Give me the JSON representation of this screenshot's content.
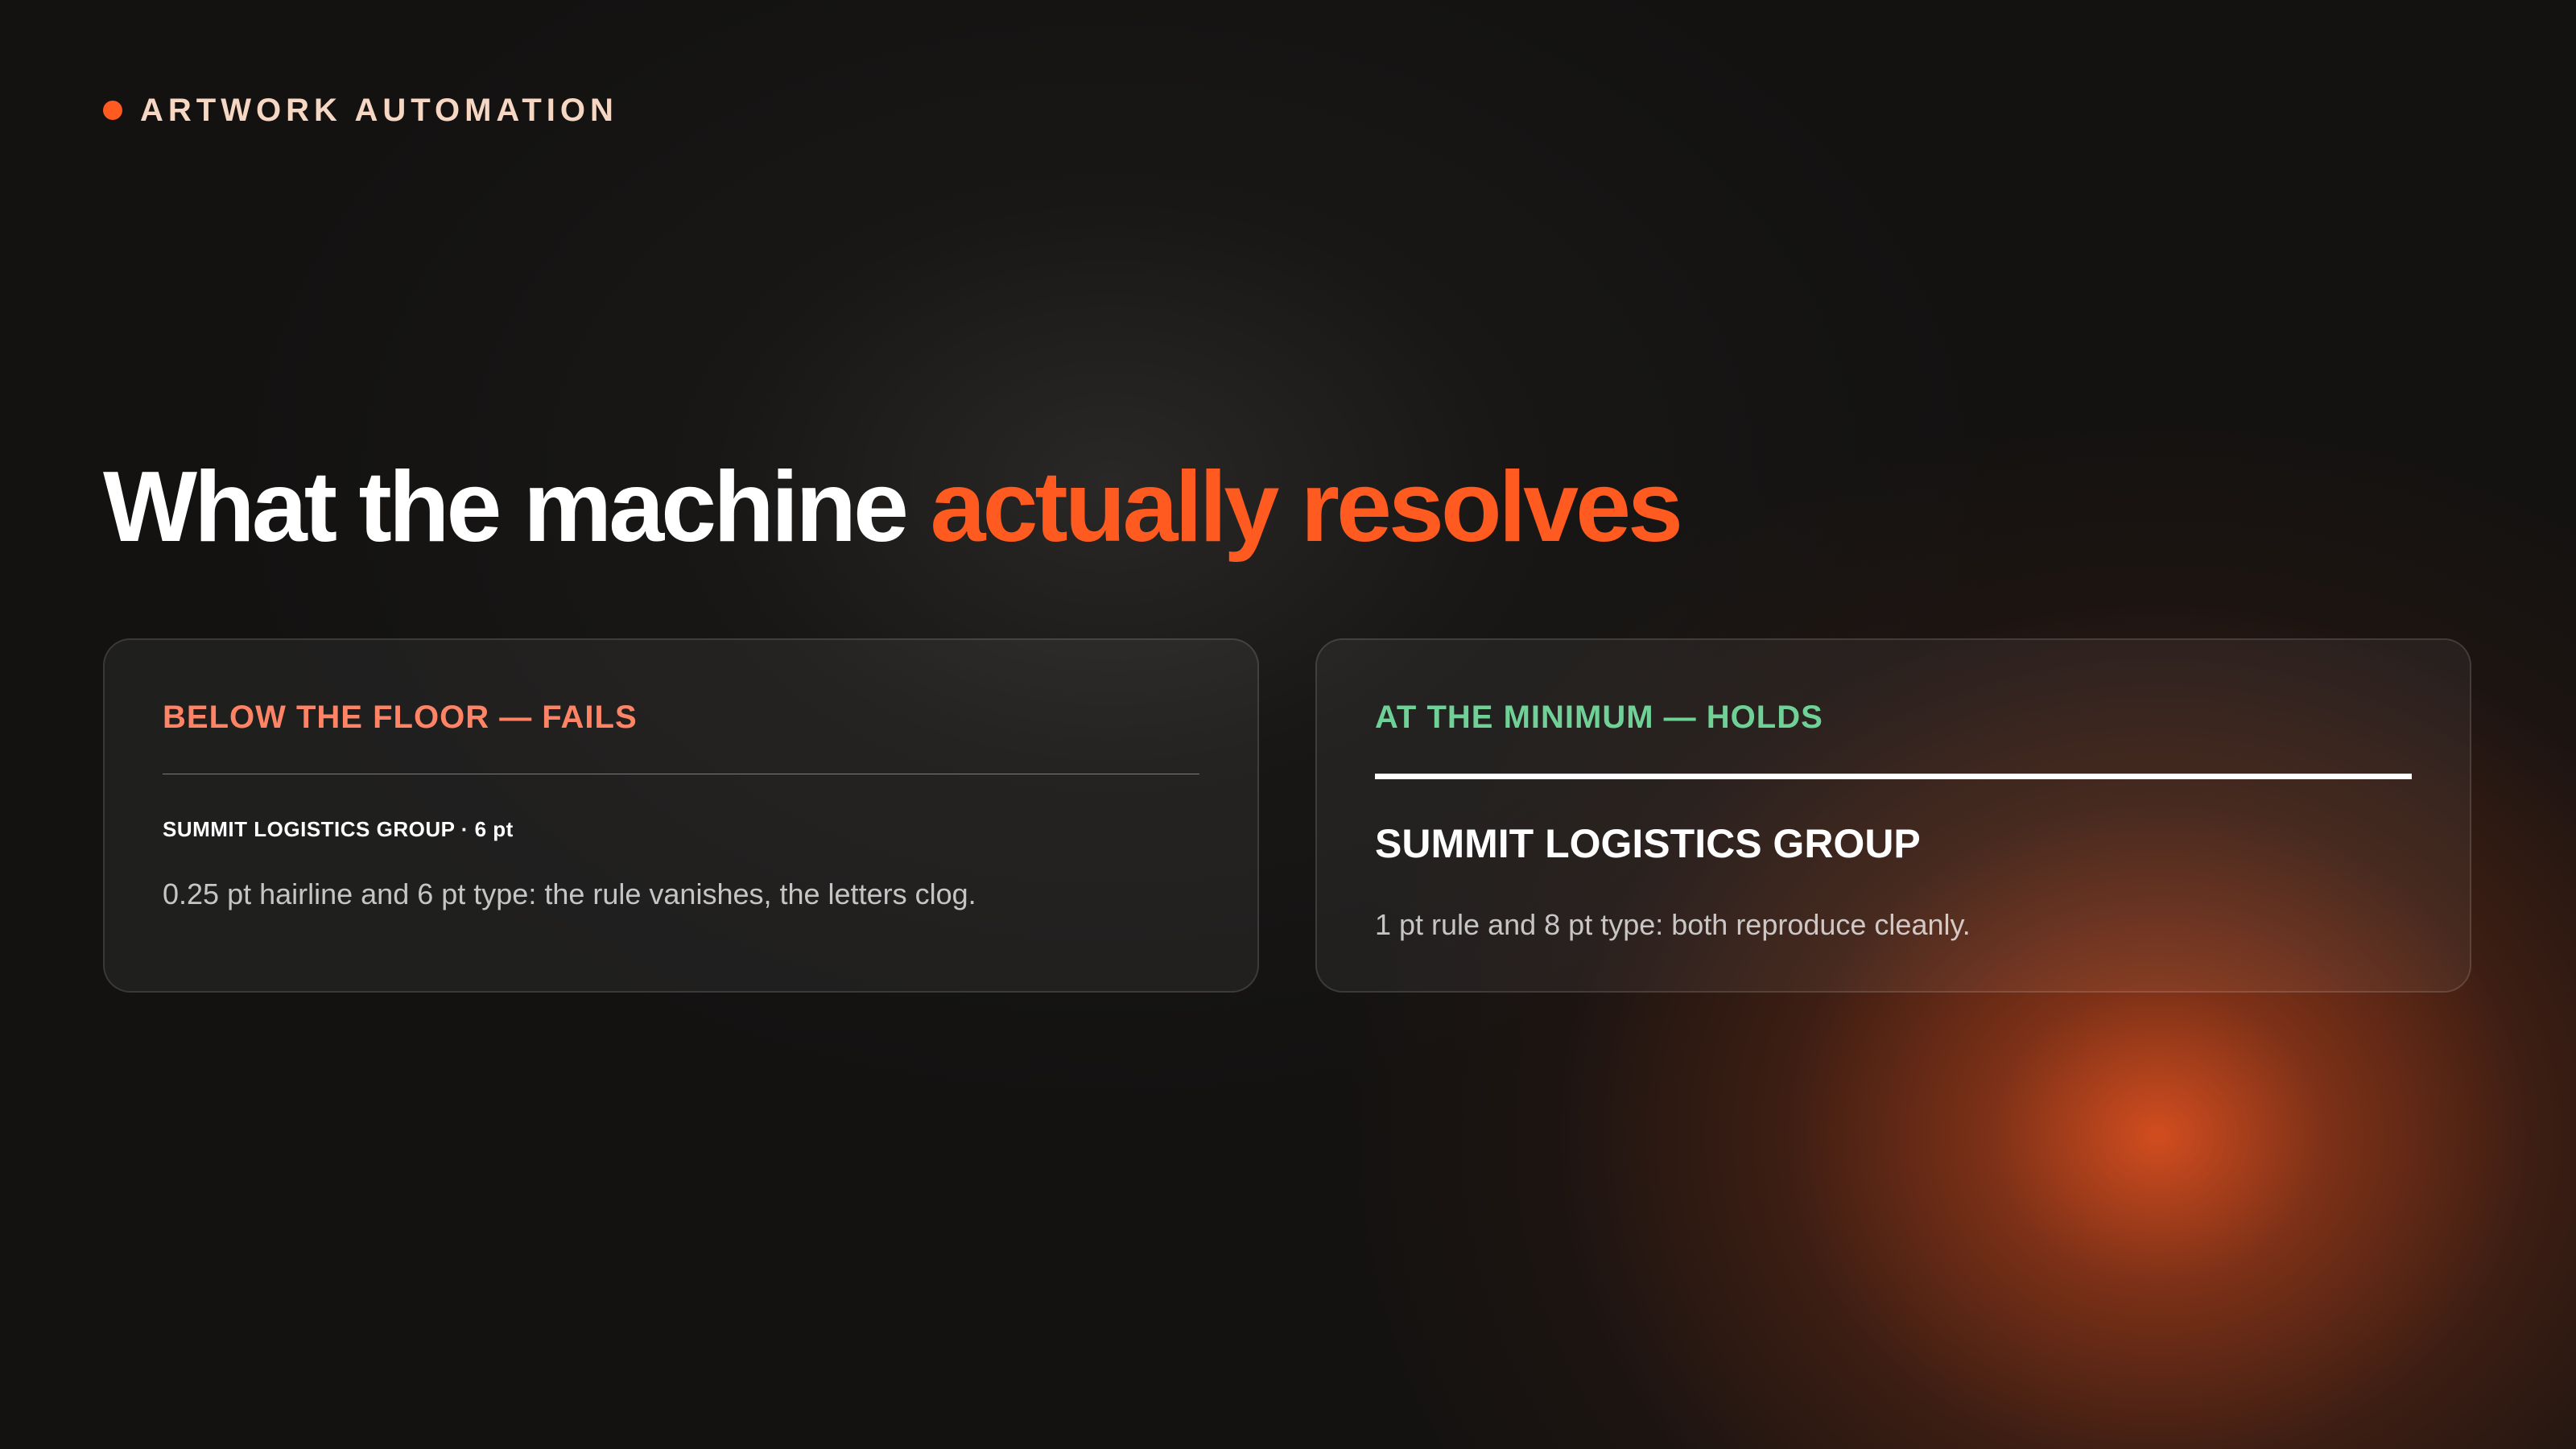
{
  "eyebrow": {
    "text": "ARTWORK AUTOMATION",
    "dot_color": "#ff5a1f"
  },
  "headline": {
    "lead": "What the machine",
    "accent": "actually resolves",
    "accent_color": "#ff5a1f"
  },
  "cards": [
    {
      "label": "BELOW THE FLOOR — FAILS",
      "label_color": "#ff8466",
      "sample": "SUMMIT LOGISTICS GROUP · 6 pt",
      "description": "0.25 pt hairline and 6 pt type: the rule vanishes, the letters clog."
    },
    {
      "label": "AT THE MINIMUM — HOLDS",
      "label_color": "#6fd196",
      "sample": "SUMMIT LOGISTICS GROUP",
      "description": "1 pt rule and 8 pt type: both reproduce cleanly."
    }
  ]
}
